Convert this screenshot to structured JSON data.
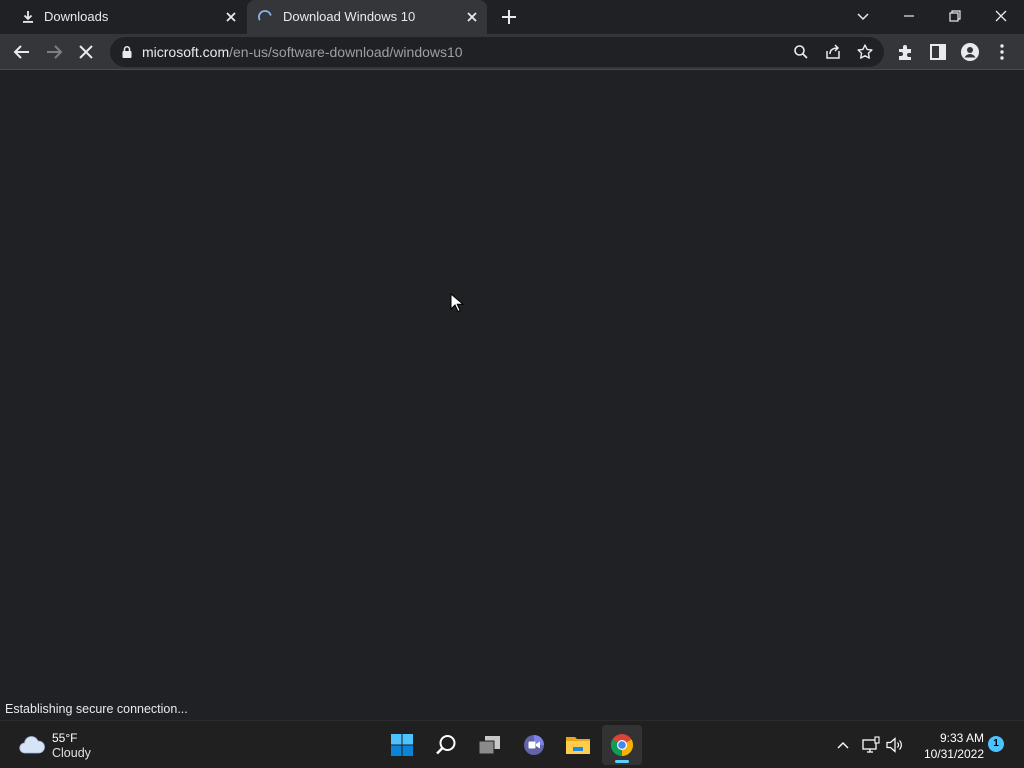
{
  "browser": {
    "tabs": [
      {
        "title": "Downloads",
        "icon": "download-icon",
        "active": false
      },
      {
        "title": "Download Windows 10",
        "icon": "loading-spinner-icon",
        "active": true
      }
    ],
    "url": {
      "host": "microsoft.com",
      "path": "/en-us/software-download/windows10"
    },
    "status_text": "Establishing secure connection...",
    "accent_color": "#8ab4f8"
  },
  "taskbar": {
    "weather": {
      "temperature": "55°F",
      "condition": "Cloudy",
      "icon": "cloud-icon"
    },
    "apps": [
      "start-icon",
      "search-icon",
      "task-view-icon",
      "teams-chat-icon",
      "file-explorer-icon",
      "chrome-icon"
    ],
    "clock": {
      "time": "9:33 AM",
      "date": "10/31/2022"
    },
    "notification_count": "1"
  }
}
